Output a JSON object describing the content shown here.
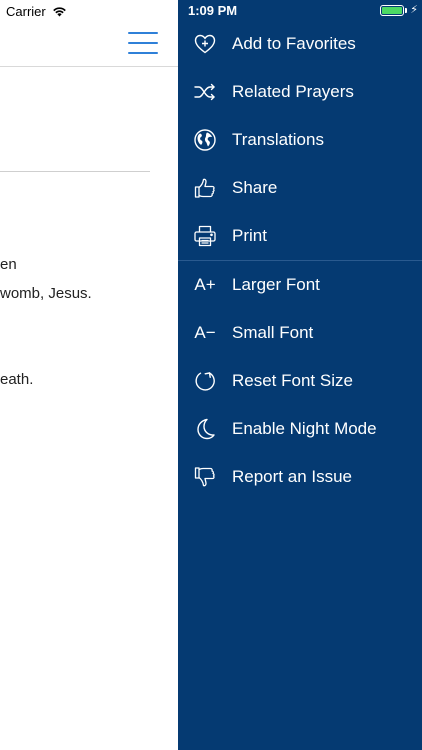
{
  "status_bar": {
    "carrier": "Carrier",
    "time": "1:09 PM",
    "battery_level": 1.0
  },
  "content": {
    "lines": [
      "en",
      "womb, Jesus.",
      "eath."
    ]
  },
  "drawer": {
    "background_color": "#053a72",
    "section1": [
      {
        "label": "Add to Favorites",
        "icon": "heart-plus-icon"
      },
      {
        "label": "Related Prayers",
        "icon": "shuffle-icon"
      },
      {
        "label": "Translations",
        "icon": "globe-icon"
      },
      {
        "label": "Share",
        "icon": "thumbs-up-icon"
      },
      {
        "label": "Print",
        "icon": "printer-icon"
      }
    ],
    "section2": [
      {
        "label": "Larger Font",
        "icon": "font-larger-icon",
        "glyph": "A+"
      },
      {
        "label": "Small Font",
        "icon": "font-smaller-icon",
        "glyph": "A−"
      },
      {
        "label": "Reset Font Size",
        "icon": "reset-icon"
      },
      {
        "label": "Enable Night Mode",
        "icon": "moon-icon"
      },
      {
        "label": "Report an Issue",
        "icon": "thumbs-down-icon"
      }
    ]
  },
  "colors": {
    "accent": "#2f80d8",
    "drawer": "#053a72",
    "battery": "#4cd964"
  }
}
